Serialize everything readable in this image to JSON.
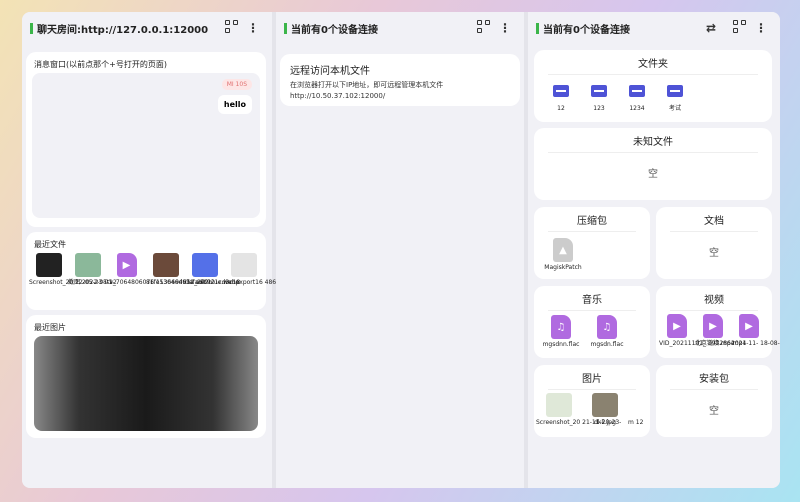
{
  "chat": {
    "title": "聊天房间:http://127.0.0.1:12000",
    "msg_title": "消息窗口(以前点那个+号打开的页面)",
    "sender": "MI 10S",
    "message": "hello",
    "recent_files_title": "最近文件",
    "recent_files": [
      "Screenshot_20 22-05-23-01-",
      "截图 2022-05-12",
      "tv_7064806076 1136694612_202",
      "81fe53046d97a e6d921cd3c18",
      "default-blue.webp",
      "mmexport16 48693050 15.jp"
    ],
    "recent_images_title": "最近图片"
  },
  "remote": {
    "title": "当前有0个设备连接",
    "card_title": "远程访问本机文件",
    "card_desc": "在浏览器打开以下IP地址，即可远程管理本机文件",
    "url": "http://10.50.37.102:12000/"
  },
  "files": {
    "title": "当前有0个设备连接",
    "folders_title": "文件夹",
    "folders": [
      "12",
      "123",
      "1234",
      "考试"
    ],
    "unknown_title": "未知文件",
    "unknown_empty": "空",
    "zip_title": "压缩包",
    "zips": [
      "MagiskPatch"
    ],
    "docs_title": "文档",
    "docs_empty": "空",
    "music_title": "音乐",
    "music": [
      "mgsdnn.flac",
      "mgsdn.flac"
    ],
    "video_title": "视频",
    "videos": [
      "VID_20211101_ 193286.mp4",
      "北京链接.mp4",
      "2021-11- 18-08-1"
    ],
    "pics_title": "图片",
    "pics": [
      "Screenshot_20 21-11-20-23-",
      "dkli.jpg",
      "m 12"
    ],
    "apk_title": "安装包",
    "apk_empty": "空"
  },
  "colors": {
    "accent": "#3bb54a",
    "folder": "#4e53d6",
    "media": "#b06ae0"
  }
}
